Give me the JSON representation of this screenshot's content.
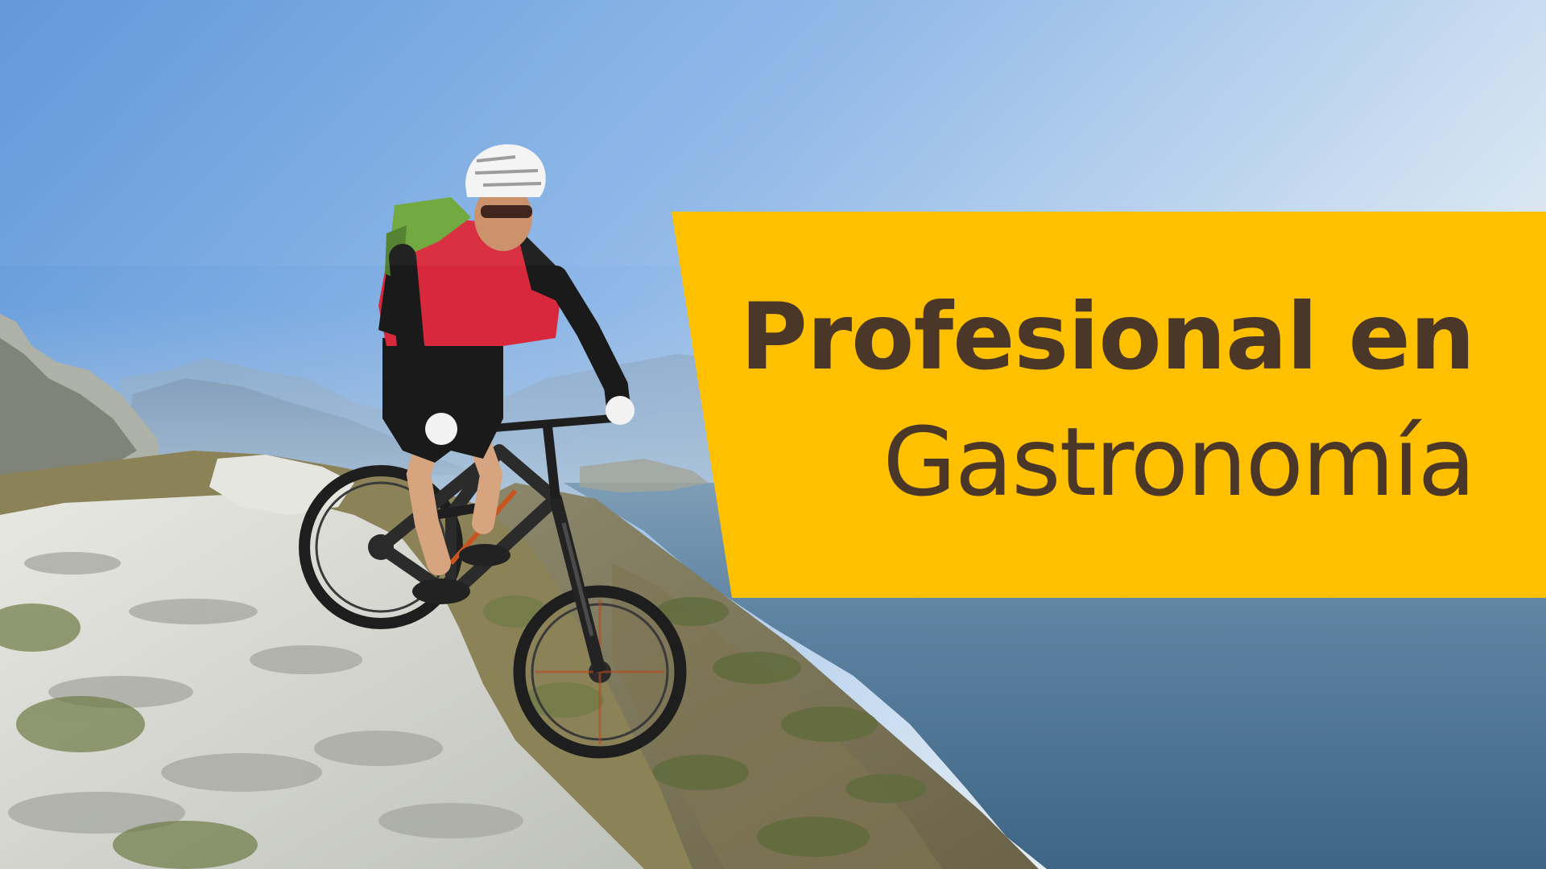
{
  "banner": {
    "title_line_1": "Profesional en",
    "title_line_2": "Gastronomía"
  },
  "colors": {
    "banner_fill": "#FFC000",
    "title_text": "#4A3728",
    "sky_top": "#5B95D8",
    "sky_bottom_right": "#F0F4F8",
    "lake": "#4F7594",
    "rock": "#D7D9D5",
    "jersey_red": "#D8283B"
  }
}
